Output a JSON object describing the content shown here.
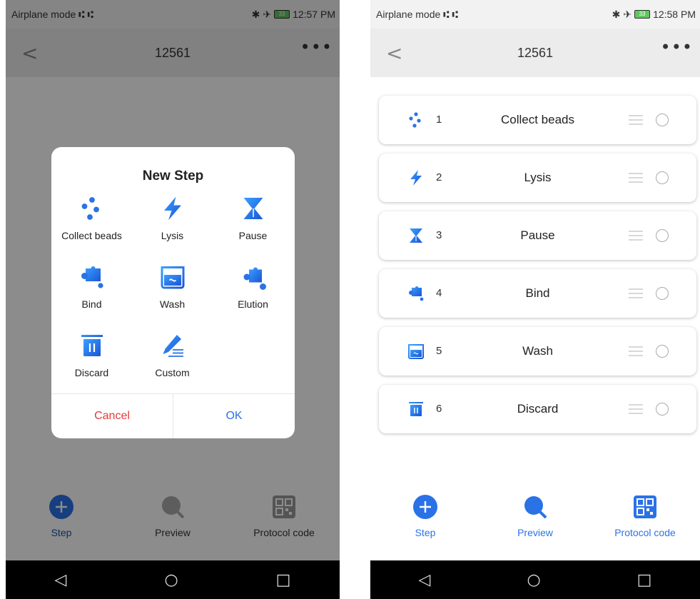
{
  "left": {
    "status": {
      "left": "Airplane mode ⑆ ⑆",
      "time": "12:57 PM",
      "battery": "33"
    },
    "title": "12561",
    "dialog": {
      "title": "New Step",
      "items": [
        {
          "label": "Collect beads",
          "icon": "collect-beads-icon"
        },
        {
          "label": "Lysis",
          "icon": "lysis-icon"
        },
        {
          "label": "Pause",
          "icon": "pause-icon"
        },
        {
          "label": "Bind",
          "icon": "bind-icon"
        },
        {
          "label": "Wash",
          "icon": "wash-icon"
        },
        {
          "label": "Elution",
          "icon": "elution-icon"
        },
        {
          "label": "Discard",
          "icon": "discard-icon"
        },
        {
          "label": "Custom",
          "icon": "custom-icon"
        }
      ],
      "cancel": "Cancel",
      "ok": "OK"
    },
    "bottom": {
      "step": "Step",
      "preview": "Preview",
      "protocol": "Protocol code"
    }
  },
  "right": {
    "status": {
      "left": "Airplane mode ⑆ ⑆",
      "time": "12:58 PM",
      "battery": "33"
    },
    "title": "12561",
    "steps": [
      {
        "num": "1",
        "name": "Collect beads",
        "icon": "collect-beads-icon"
      },
      {
        "num": "2",
        "name": "Lysis",
        "icon": "lysis-icon"
      },
      {
        "num": "3",
        "name": "Pause",
        "icon": "pause-icon"
      },
      {
        "num": "4",
        "name": "Bind",
        "icon": "bind-icon"
      },
      {
        "num": "5",
        "name": "Wash",
        "icon": "wash-icon"
      },
      {
        "num": "6",
        "name": "Discard",
        "icon": "discard-icon"
      }
    ],
    "bottom": {
      "step": "Step",
      "preview": "Preview",
      "protocol": "Protocol code"
    }
  },
  "colors": {
    "accent": "#2a72e6",
    "cancel": "#e53935"
  }
}
